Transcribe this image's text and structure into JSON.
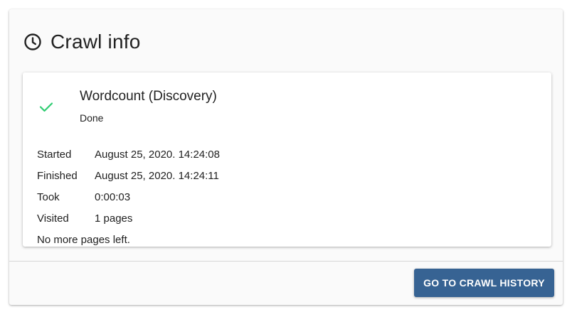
{
  "card": {
    "title": "Crawl info",
    "title_icon": "clock-icon"
  },
  "job": {
    "name": "Wordcount (Discovery)",
    "status": "Done",
    "status_icon": "checkmark-icon",
    "status_color": "#2ecc71"
  },
  "details": [
    {
      "label": "Started",
      "value": "August 25, 2020. 14:24:08"
    },
    {
      "label": "Finished",
      "value": "August 25, 2020. 14:24:11"
    },
    {
      "label": "Took",
      "value": "0:00:03"
    },
    {
      "label": "Visited",
      "value": "1 pages"
    }
  ],
  "note": "No more pages left.",
  "actions": {
    "history_label": "GO TO CRAWL HISTORY",
    "button_color": "#376393"
  }
}
